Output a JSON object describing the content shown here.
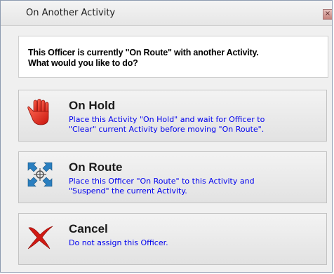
{
  "window": {
    "title": "On Another Activity",
    "close_glyph": "×"
  },
  "message": {
    "line1": "This Officer is currently \"On Route\" with another Activity.",
    "line2": "What would you like to do?"
  },
  "options": [
    {
      "title": "On Hold",
      "line1": "Place this Activity  \"On Hold\" and wait for Officer to",
      "line2": "\"Clear\" current Activity before moving  \"On Route\".",
      "icon": "hand-stop-icon",
      "icon_color": "#e0261b"
    },
    {
      "title": "On Route",
      "line1": "Place this Officer  \"On Route\" to this Activity and",
      "line2": "\"Suspend\" the current Activity.",
      "icon": "converge-arrows-icon",
      "icon_color": "#2a7fc0"
    },
    {
      "title": "Cancel",
      "line1": "Do not assign this Officer.",
      "icon": "cancel-x-icon",
      "icon_color": "#d11a14"
    }
  ],
  "colors": {
    "description_text": "#0000ee",
    "panel_border": "#c3c3c3"
  }
}
